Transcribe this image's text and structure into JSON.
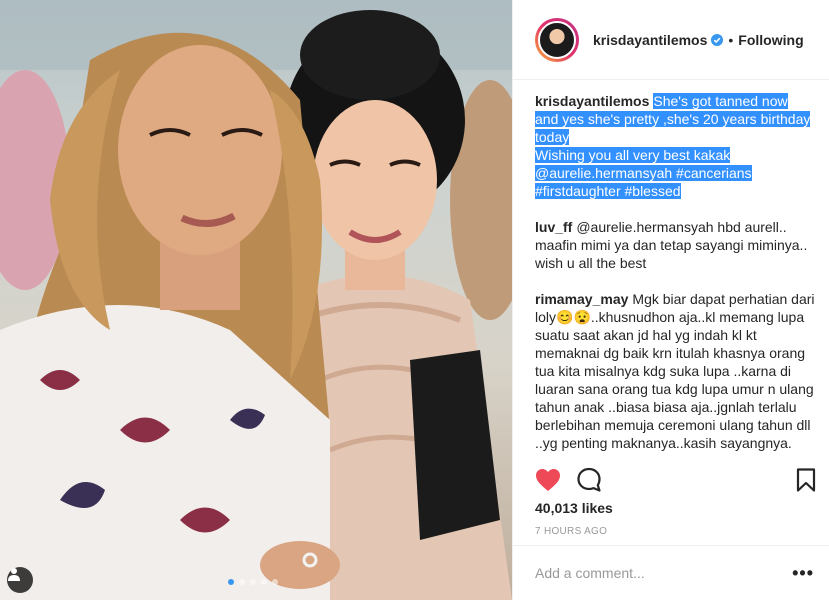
{
  "post": {
    "username": "krisdayantilemos",
    "separator": "•",
    "follow_label": "Following"
  },
  "caption": {
    "author": "krisdayantilemos",
    "lines": [
      "She's got tanned now",
      "and yes she's pretty ,she's 20 years birthday",
      "today",
      "Wishing you all very best kakak",
      "@aurelie.hermansyah #cancerians",
      "#firstdaughter #blessed"
    ]
  },
  "comments": [
    {
      "author": "luv_ff",
      "text": "@aurelie.hermansyah hbd aurell.. maafin mimi ya dan tetap sayangi miminya.. wish u all the best"
    },
    {
      "author": "rimamay_may",
      "text": "Mgk biar dapat perhatian dari loly😊😧..khusnudhon aja..kl memang lupa suatu saat akan jd hal yg indah kl kt memaknai dg baik krn itulah khasnya orang tua kita misalnya kdg suka lupa ..karna di luaran sana orang tua kdg lupa umur n ulang tahun anak ..biasa biasa aja..jgnlah terlalu berlebihan memuja ceremoni ulang tahun dll ..yg penting maknanya..kasih sayangnya."
    }
  ],
  "likes": "40,013 likes",
  "timestamp": "7 HOURS AGO",
  "add_comment_placeholder": "Add a comment...",
  "more_label": "•••",
  "colors": {
    "like_heart": "#ed4956",
    "verified_badge": "#3897f0",
    "caption_highlight": "#3390ff",
    "carousel_dot_active": "#3897f0"
  },
  "icons": {
    "verified": "verified-badge-icon",
    "like": "heart-icon",
    "comment": "comment-bubble-icon",
    "save": "bookmark-icon",
    "tag": "person-tag-icon"
  },
  "carousel": {
    "count": 5,
    "active_index": 0
  }
}
